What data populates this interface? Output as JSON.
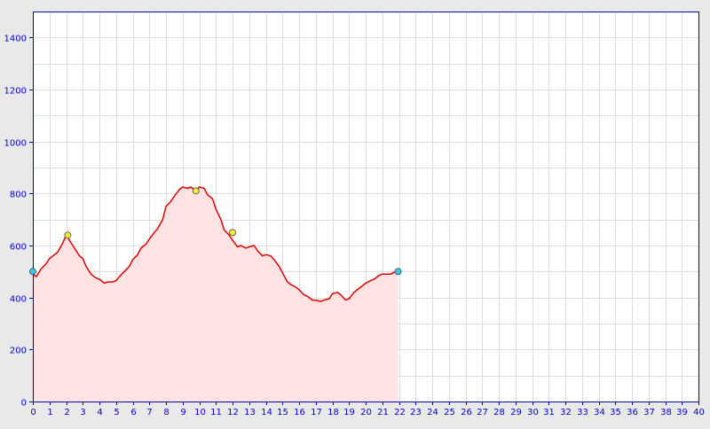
{
  "chart_data": {
    "type": "area",
    "title": "",
    "xlabel": "",
    "ylabel": "",
    "xlim": [
      0,
      40
    ],
    "ylim": [
      0,
      1500
    ],
    "x_ticks": [
      0,
      1,
      2,
      3,
      4,
      5,
      6,
      7,
      8,
      9,
      10,
      11,
      12,
      13,
      14,
      15,
      16,
      17,
      18,
      19,
      20,
      21,
      22,
      23,
      24,
      25,
      26,
      27,
      28,
      29,
      30,
      31,
      32,
      33,
      34,
      35,
      36,
      37,
      38,
      39,
      40
    ],
    "y_ticks": [
      0,
      200,
      400,
      600,
      800,
      1000,
      1200,
      1400
    ],
    "grid": true,
    "legend": "none",
    "colors": {
      "page_bg": "#e9e9e9",
      "plot_bg": "#ffffff",
      "frame": "#0000aa",
      "grid": "#dddddd",
      "tick_label": "#0000cc",
      "line": "#dd0000",
      "fill": "#ffe3e3",
      "marker_endpoint": "#33ccee",
      "marker_waypoint": "#ffee33"
    },
    "series": [
      {
        "x": [
          0,
          0.2,
          0.5,
          0.8,
          1.0,
          1.3,
          1.5,
          1.8,
          2.0,
          2.2,
          2.5,
          2.8,
          3.0,
          3.2,
          3.5,
          3.8,
          4.0,
          4.3,
          4.5,
          4.8,
          5.0,
          5.2,
          5.5,
          5.8,
          6.0,
          6.3,
          6.5,
          6.8,
          7.0,
          7.3,
          7.5,
          7.8,
          8.0,
          8.3,
          8.5,
          8.8,
          9.0,
          9.3,
          9.5,
          9.8,
          10.0,
          10.3,
          10.5,
          10.8,
          11.0,
          11.3,
          11.5,
          11.8,
          12.0,
          12.3,
          12.5,
          12.8,
          13.0,
          13.3,
          13.5,
          13.8,
          14.0,
          14.3,
          14.5,
          14.8,
          15.0,
          15.3,
          15.5,
          15.8,
          16.0,
          16.3,
          16.5,
          16.8,
          17.0,
          17.3,
          17.5,
          17.8,
          18.0,
          18.3,
          18.5,
          18.8,
          19.0,
          19.3,
          19.5,
          19.8,
          20.0,
          20.3,
          20.5,
          20.8,
          21.0,
          21.3,
          21.5,
          21.8,
          21.95
        ],
        "y": [
          490,
          480,
          510,
          530,
          550,
          565,
          575,
          610,
          640,
          620,
          590,
          560,
          550,
          520,
          490,
          475,
          470,
          455,
          460,
          460,
          465,
          480,
          500,
          520,
          545,
          565,
          590,
          605,
          625,
          650,
          665,
          700,
          750,
          770,
          790,
          815,
          825,
          820,
          825,
          810,
          825,
          820,
          795,
          780,
          740,
          700,
          660,
          640,
          620,
          595,
          600,
          590,
          595,
          600,
          580,
          560,
          565,
          560,
          545,
          520,
          495,
          460,
          450,
          440,
          430,
          410,
          405,
          390,
          390,
          385,
          390,
          395,
          415,
          420,
          410,
          390,
          395,
          420,
          430,
          445,
          455,
          465,
          470,
          485,
          490,
          490,
          490,
          500,
          500
        ]
      }
    ],
    "markers": [
      {
        "x": 0,
        "y": 500,
        "kind": "endpoint"
      },
      {
        "x": 2.1,
        "y": 640,
        "kind": "waypoint"
      },
      {
        "x": 9.8,
        "y": 810,
        "kind": "waypoint"
      },
      {
        "x": 12.0,
        "y": 650,
        "kind": "waypoint"
      },
      {
        "x": 21.95,
        "y": 500,
        "kind": "endpoint"
      }
    ]
  }
}
